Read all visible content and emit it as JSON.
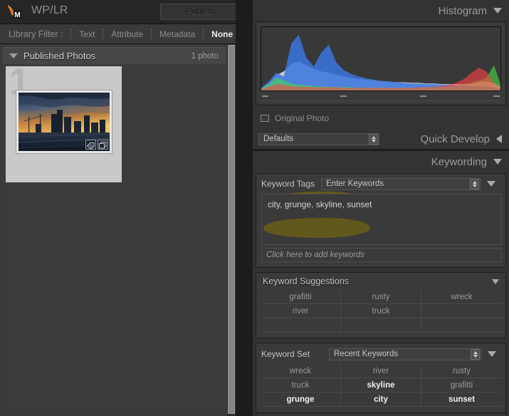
{
  "window": {
    "app_icon": "lightroom-publish-icon",
    "icon_badge": "M",
    "title": "WP/LR",
    "publish_label": "Publish"
  },
  "library_filter": {
    "label": "Library Filter :",
    "items": [
      {
        "label": "Text",
        "active": false
      },
      {
        "label": "Attribute",
        "active": false
      },
      {
        "label": "Metadata",
        "active": false
      },
      {
        "label": "None",
        "active": true
      }
    ]
  },
  "collection": {
    "title": "Published Photos",
    "count": "1 photo",
    "expanded": true
  },
  "grid": {
    "cells": [
      {
        "index": "1",
        "badges": [
          "keyword-tag-badge",
          "crop-badge"
        ],
        "alt": "city skyline at sunset"
      }
    ]
  },
  "histogram": {
    "title": "Histogram",
    "original_photo_label": "Original Photo",
    "original_photo_checked": false,
    "tick_count": 4
  },
  "quick_develop": {
    "title": "Quick Develop",
    "preset_value": "Defaults",
    "collapsed": true
  },
  "keywording": {
    "title": "Keywording",
    "expanded": true,
    "keyword_tags_label": "Keyword Tags",
    "keyword_tags_mode": "Enter Keywords",
    "keywords_text": "city, grunge, skyline, sunset",
    "add_keywords_placeholder": "Click here to add keywords",
    "highlight_color": "#6b6015"
  },
  "keyword_suggestions": {
    "title": "Keyword Suggestions",
    "cells": [
      {
        "label": "grafitti",
        "applied": false
      },
      {
        "label": "rusty",
        "applied": false
      },
      {
        "label": "wreck",
        "applied": false
      },
      {
        "label": "river",
        "applied": false
      },
      {
        "label": "truck",
        "applied": false
      },
      {
        "label": "",
        "applied": false
      },
      {
        "label": "",
        "applied": false
      },
      {
        "label": "",
        "applied": false
      },
      {
        "label": "",
        "applied": false
      }
    ]
  },
  "keyword_set": {
    "label": "Keyword Set",
    "value": "Recent Keywords",
    "cells": [
      {
        "label": "wreck",
        "applied": false
      },
      {
        "label": "river",
        "applied": false
      },
      {
        "label": "rusty",
        "applied": false
      },
      {
        "label": "truck",
        "applied": false
      },
      {
        "label": "skyline",
        "applied": true
      },
      {
        "label": "grafitti",
        "applied": false
      },
      {
        "label": "grunge",
        "applied": true
      },
      {
        "label": "city",
        "applied": true
      },
      {
        "label": "sunset",
        "applied": true
      }
    ]
  },
  "chart_data": {
    "type": "area",
    "title": "Histogram",
    "xlabel": "",
    "ylabel": "",
    "xlim": [
      0,
      255
    ],
    "ylim": [
      0,
      100
    ],
    "grid": false,
    "legend": "none",
    "x": [
      0,
      8,
      16,
      24,
      32,
      40,
      48,
      56,
      64,
      72,
      80,
      88,
      96,
      104,
      112,
      120,
      128,
      136,
      144,
      152,
      160,
      168,
      176,
      184,
      192,
      200,
      208,
      216,
      224,
      232,
      240,
      248,
      255
    ],
    "series": [
      {
        "name": "red",
        "color": "#ff4444",
        "values": [
          2,
          6,
          10,
          9,
          7,
          6,
          6,
          5,
          5,
          5,
          5,
          4,
          4,
          4,
          4,
          4,
          4,
          4,
          4,
          4,
          4,
          5,
          5,
          6,
          7,
          9,
          12,
          18,
          28,
          36,
          30,
          12,
          4
        ]
      },
      {
        "name": "green",
        "color": "#44dd44",
        "values": [
          3,
          10,
          20,
          16,
          11,
          9,
          8,
          7,
          6,
          6,
          5,
          5,
          5,
          4,
          4,
          4,
          4,
          4,
          4,
          4,
          4,
          4,
          5,
          5,
          5,
          6,
          7,
          9,
          12,
          16,
          20,
          40,
          10
        ]
      },
      {
        "name": "blue",
        "color": "#3a76e0",
        "values": [
          4,
          14,
          28,
          22,
          74,
          88,
          52,
          38,
          60,
          72,
          44,
          32,
          26,
          22,
          19,
          17,
          15,
          14,
          13,
          12,
          11,
          11,
          10,
          10,
          9,
          9,
          8,
          8,
          7,
          7,
          6,
          5,
          3
        ]
      },
      {
        "name": "luminance",
        "color": "#d8d8d8",
        "values": [
          3,
          12,
          24,
          30,
          42,
          46,
          40,
          34,
          30,
          28,
          25,
          22,
          20,
          18,
          17,
          16,
          15,
          14,
          13,
          13,
          12,
          12,
          11,
          11,
          10,
          10,
          10,
          10,
          11,
          13,
          14,
          12,
          5
        ]
      }
    ],
    "notes": "RGB overlap histogram: tall yellow (red+green) spike at shadows, strong blue peak in dark tones, cyan mid-shadow region, gray luminance body, red/green highlight clipping at right edge"
  }
}
